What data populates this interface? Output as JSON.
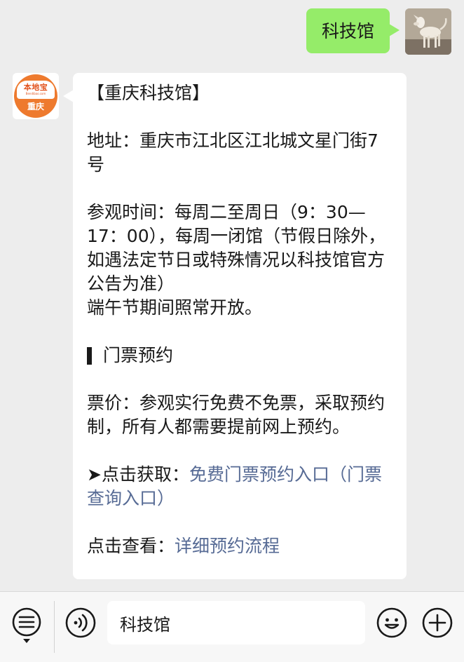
{
  "outgoing": {
    "text": "科技馆"
  },
  "brand": {
    "name": "本地宝",
    "url": "Bendibao.com",
    "city": "重庆"
  },
  "message": {
    "title": "【重庆科技馆】",
    "address": "地址：重庆市江北区江北城文星门街7号",
    "hours": "参观时间：每周二至周日（9：30—17：00），每周一闭馆（节假日除外，如遇法定节日或特殊情况以科技馆官方公告为准）",
    "dragon_boat": "端午节期间照常开放。",
    "ticket_heading": "门票预约",
    "price": "票价：参观实行免费不免票，采取预约制，所有人都需要提前网上预约。",
    "get_prefix": "➤点击获取：",
    "get_link": "免费门票预约入口（门票查询入口）",
    "view_prefix": "点击查看：",
    "view_link": "详细预约流程"
  },
  "input": {
    "value": "科技馆"
  },
  "icons": {
    "menu": "menu-list-icon",
    "voice": "voice-icon",
    "emoji": "emoji-icon",
    "plus": "plus-icon"
  },
  "colors": {
    "outgoing_bubble": "#95ec69",
    "link": "#576b95",
    "brand_orange": "#ee7a2e",
    "background": "#ededed"
  }
}
